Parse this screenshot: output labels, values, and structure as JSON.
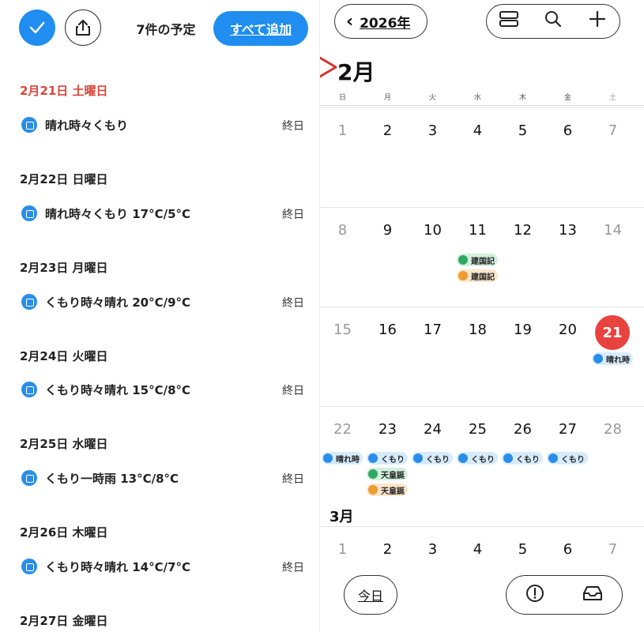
{
  "left": {
    "header": {
      "title": "7件の予定",
      "add_all_label": "すべて追加"
    },
    "days": [
      {
        "date": "2月21日 土曜日",
        "saturday": true,
        "event": "晴れ時々くもり",
        "allday": "終日"
      },
      {
        "date": "2月22日 日曜日",
        "saturday": false,
        "event": "晴れ時々くもり 17°C/5°C",
        "allday": "終日"
      },
      {
        "date": "2月23日 月曜日",
        "saturday": false,
        "event": "くもり時々晴れ 20°C/9°C",
        "allday": "終日"
      },
      {
        "date": "2月24日 火曜日",
        "saturday": false,
        "event": "くもり時々晴れ 15°C/8°C",
        "allday": "終日"
      },
      {
        "date": "2月25日 水曜日",
        "saturday": false,
        "event": "くもり一時雨 13°C/8°C",
        "allday": "終日"
      },
      {
        "date": "2月26日 木曜日",
        "saturday": false,
        "event": "くもり時々晴れ 14°C/7°C",
        "allday": "終日"
      },
      {
        "date": "2月27日 金曜日",
        "saturday": false,
        "event": "",
        "allday": ""
      }
    ]
  },
  "right": {
    "year_label": "2026年",
    "month_title": "2月",
    "weekdays": [
      "日",
      "月",
      "火",
      "水",
      "木",
      "金",
      "土"
    ],
    "weeks": [
      {
        "days": [
          "1",
          "2",
          "3",
          "4",
          "5",
          "6",
          "7"
        ]
      },
      {
        "days": [
          "8",
          "9",
          "10",
          "11",
          "12",
          "13",
          "14"
        ]
      },
      {
        "days": [
          "15",
          "16",
          "17",
          "18",
          "19",
          "20",
          "21"
        ]
      },
      {
        "days": [
          "22",
          "23",
          "24",
          "25",
          "26",
          "27",
          "28"
        ]
      }
    ],
    "events": {
      "w1_d3_a": "建国記",
      "w1_d3_b": "建国記",
      "w2_d6": "晴れ時",
      "w3_d0": "晴れ時",
      "w3_d1": "くもり",
      "w3_d1_b": "天皇誕",
      "w3_d1_c": "天皇誕",
      "w3_d2": "くもり",
      "w3_d3": "くもり",
      "w3_d4": "くもり",
      "w3_d5": "くもり"
    },
    "march_title": "3月",
    "march_days": [
      "1",
      "2",
      "3",
      "4",
      "5",
      "6",
      "7"
    ],
    "today_label": "今日",
    "colors": {
      "today": "#e9433f",
      "accent": "#1f8ef0"
    }
  }
}
